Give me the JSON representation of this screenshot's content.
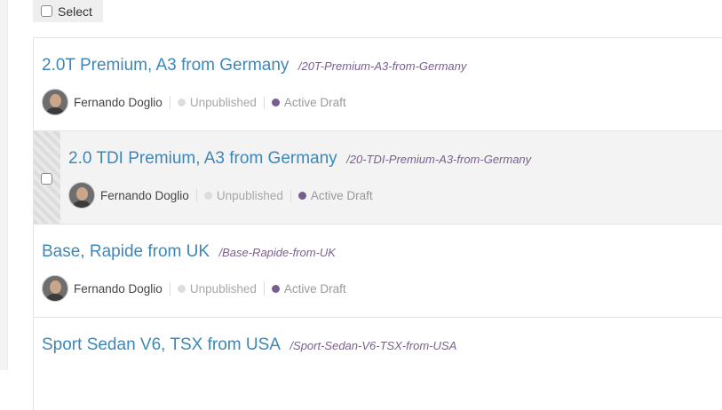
{
  "toolbar": {
    "select_label": "Select"
  },
  "entries": [
    {
      "title": "2.0T Premium, A3 from Germany",
      "slug": "/20T-Premium-A3-from-Germany",
      "author": "Fernando Doglio",
      "status": "Unpublished",
      "draft": "Active Draft"
    },
    {
      "title": "2.0 TDI Premium, A3 from Germany",
      "slug": "/20-TDI-Premium-A3-from-Germany",
      "author": "Fernando Doglio",
      "status": "Unpublished",
      "draft": "Active Draft"
    },
    {
      "title": "Base, Rapide from UK",
      "slug": "/Base-Rapide-from-UK",
      "author": "Fernando Doglio",
      "status": "Unpublished",
      "draft": "Active Draft"
    },
    {
      "title": "Sport Sedan V6, TSX from USA",
      "slug": "/Sport-Sedan-V6-TSX-from-USA"
    }
  ],
  "colors": {
    "title": "#3d87b8",
    "slug": "#7a5f8e",
    "active_draft_dot": "#7a5f8e",
    "unpublished_dot": "#dddddd"
  }
}
